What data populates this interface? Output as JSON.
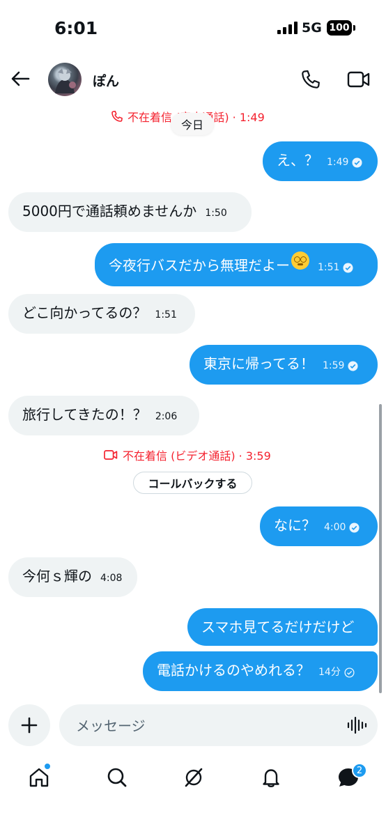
{
  "status_bar": {
    "time": "6:01",
    "network": "5G",
    "battery": "100"
  },
  "header": {
    "contact_name": "ぽん"
  },
  "date_divider": "今日",
  "missed_call_top": {
    "text": "不在着信 (音声通話) · 1:49"
  },
  "messages": [
    {
      "text": "え、？",
      "time": "1:49",
      "side": "out"
    },
    {
      "text": "5000円で通話頼めませんか",
      "time": "1:50",
      "side": "in"
    },
    {
      "text": "今夜行バスだから無理だよー",
      "time": "1:51",
      "side": "out",
      "emoji": "dizzy-face"
    },
    {
      "text": "どこ向かってるの？",
      "time": "1:51",
      "side": "in"
    },
    {
      "text": "東京に帰ってる！",
      "time": "1:59",
      "side": "out"
    },
    {
      "text": "旅行してきたの！？",
      "time": "2:06",
      "side": "in"
    },
    {
      "text": "なに？",
      "time": "4:00",
      "side": "out"
    },
    {
      "text": "今何ｓ輝の",
      "time": "4:08",
      "side": "in"
    },
    {
      "text": "スマホ見てるだけだけど",
      "time": "",
      "side": "out"
    },
    {
      "text": "電話かけるのやめれる？",
      "time": "14分",
      "side": "out"
    }
  ],
  "missed_call_video": {
    "text": "不在着信 (ビデオ通話) · 3:59"
  },
  "callback_button": "コールバックする",
  "composer": {
    "placeholder": "メッセージ"
  },
  "bottom_nav": {
    "messages_badge": "2"
  },
  "colors": {
    "accent": "#1d9bf0",
    "incoming_bubble": "#eff3f4",
    "missed": "#f4212e"
  }
}
